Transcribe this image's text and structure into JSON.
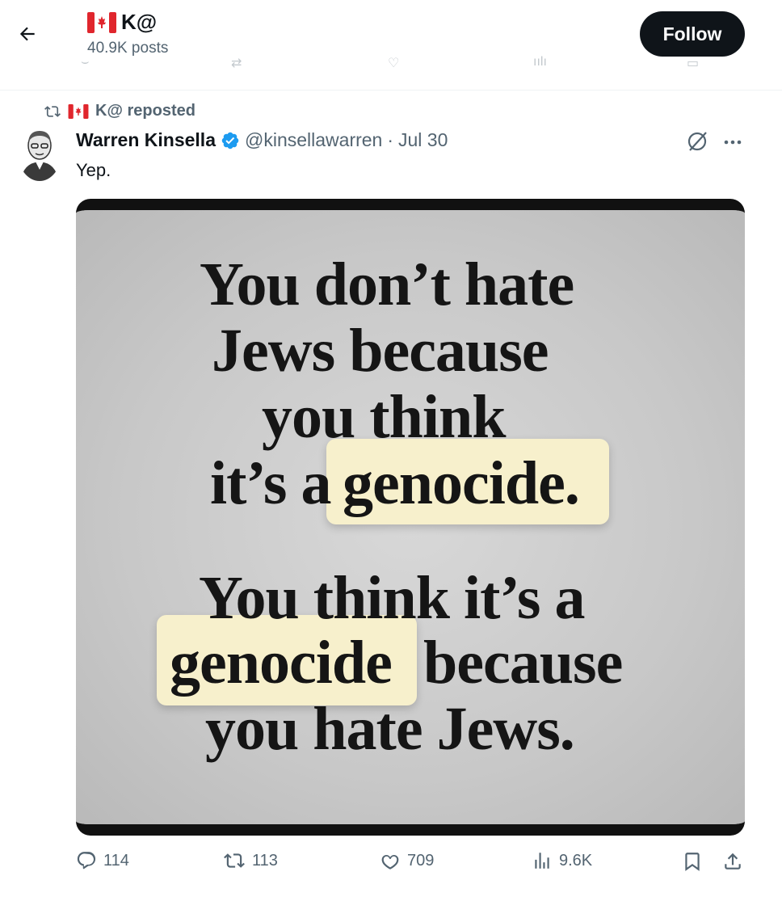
{
  "header": {
    "account_flag": "canada-flag-icon",
    "account_name": "K@",
    "post_count": "40.9K posts",
    "follow_label": "Follow"
  },
  "repost": {
    "label": "K@ reposted"
  },
  "tweet": {
    "author": "Warren Kinsella",
    "handle": "@kinsellawarren",
    "separator": "·",
    "date": "Jul 30",
    "text": "Yep."
  },
  "media": {
    "lines": [
      "You don’t hate",
      "Jews because",
      "you think",
      "it’s a",
      "genocide.",
      "You think it’s a",
      "genocide",
      "because",
      "you hate Jews."
    ],
    "highlight_color": "#f7f0cc"
  },
  "actions": {
    "replies": "114",
    "reposts": "113",
    "likes": "709",
    "views": "9.6K"
  },
  "colors": {
    "text": "#0f1419",
    "secondary": "#536471",
    "verified": "#1d9bf0",
    "follow_bg": "#0f1419"
  }
}
